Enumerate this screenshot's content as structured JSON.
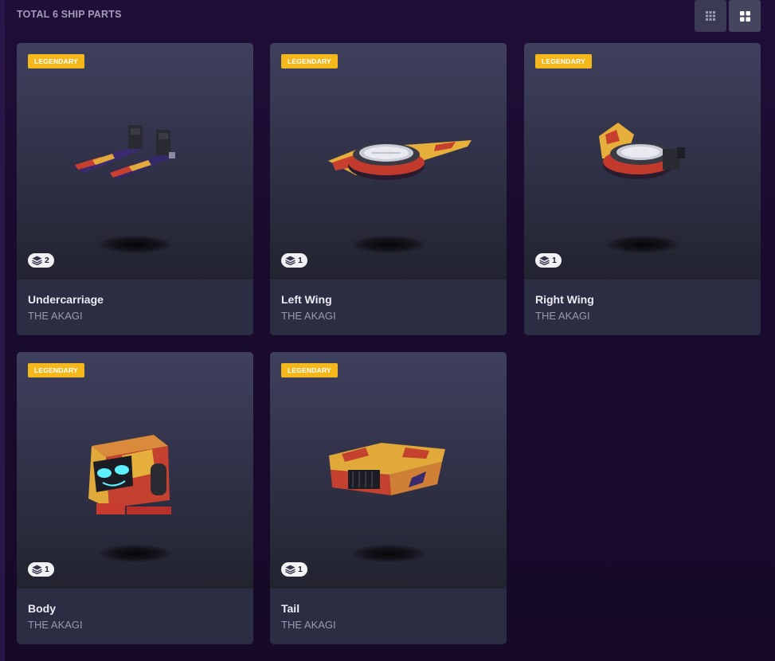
{
  "header": {
    "title": "TOTAL 6 SHIP PARTS"
  },
  "parts": [
    {
      "rarity": "LEGENDARY",
      "count": "2",
      "name": "Undercarriage",
      "ship": "THE AKAGI"
    },
    {
      "rarity": "LEGENDARY",
      "count": "1",
      "name": "Left Wing",
      "ship": "THE AKAGI"
    },
    {
      "rarity": "LEGENDARY",
      "count": "1",
      "name": "Right Wing",
      "ship": "THE AKAGI"
    },
    {
      "rarity": "LEGENDARY",
      "count": "1",
      "name": "Body",
      "ship": "THE AKAGI"
    },
    {
      "rarity": "LEGENDARY",
      "count": "1",
      "name": "Tail",
      "ship": "THE AKAGI"
    }
  ],
  "icons": {
    "small_grid": "small-grid-icon",
    "large_grid": "large-grid-icon",
    "stack": "layers-icon"
  },
  "colors": {
    "legendary": "#f5b81c"
  }
}
